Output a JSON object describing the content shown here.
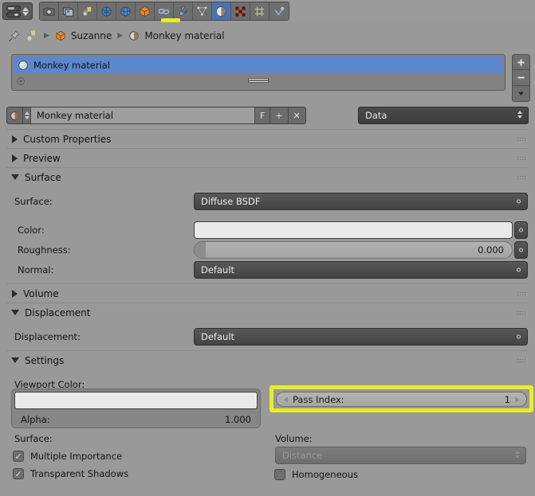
{
  "editor": {
    "type_label": "properties-editor"
  },
  "toolbar": {
    "tabs": [
      {
        "name": "render-tab",
        "icon": "camera-icon"
      },
      {
        "name": "output-tab",
        "icon": "printer-icon"
      },
      {
        "name": "view-layer-tab",
        "icon": "images-icon"
      },
      {
        "name": "scene-tab",
        "icon": "cone-sphere-icon"
      },
      {
        "name": "world-tab",
        "icon": "globe-icon"
      },
      {
        "name": "object-tab",
        "icon": "cube-icon"
      },
      {
        "name": "constraints-tab",
        "icon": "chain-icon"
      },
      {
        "name": "modifiers-tab",
        "icon": "wrench-icon"
      },
      {
        "name": "particles-tab",
        "icon": "particles-icon"
      },
      {
        "name": "material-tab",
        "icon": "material-sphere-icon",
        "active": true
      },
      {
        "name": "texture-tab",
        "icon": "checker-icon"
      },
      {
        "name": "physics-tab",
        "icon": "physics-icon"
      },
      {
        "name": "data-tab",
        "icon": "mesh-data-icon"
      }
    ]
  },
  "breadcrumb": {
    "pin_icon": "pin-icon",
    "root_icon": "material-data-icon",
    "items": [
      {
        "label": "Suzanne",
        "icon": "object-cube-icon"
      },
      {
        "label": "Monkey material",
        "icon": "material-sphere-icon"
      }
    ]
  },
  "slot_list": {
    "items": [
      {
        "label": "Monkey material",
        "selected": true
      }
    ],
    "add_icon": "plus-circle-icon",
    "side_buttons": [
      {
        "name": "add-slot-button",
        "glyph": "+"
      },
      {
        "name": "remove-slot-button",
        "glyph": "–"
      },
      {
        "name": "slot-specials-button",
        "glyph": "▾"
      }
    ]
  },
  "name_row": {
    "browse_icon": "material-browse-icon",
    "value": "Monkey material",
    "fake_user_label": "F",
    "new_label": "+",
    "unlink_label": "✕",
    "link_dropdown": {
      "value": "Data"
    }
  },
  "panels": [
    {
      "name": "custom-properties",
      "label": "Custom Properties",
      "open": false
    },
    {
      "name": "preview",
      "label": "Preview",
      "open": false
    },
    {
      "name": "surface",
      "label": "Surface",
      "open": true
    },
    {
      "name": "volume",
      "label": "Volume",
      "open": false
    },
    {
      "name": "displacement",
      "label": "Displacement",
      "open": true
    },
    {
      "name": "settings",
      "label": "Settings",
      "open": true
    }
  ],
  "surface": {
    "surface_label": "Surface:",
    "surface_value": "Diffuse BSDF",
    "color_label": "Color:",
    "color_value": "#e9e9e9",
    "roughness_label": "Roughness:",
    "roughness_value": "0.000",
    "normal_label": "Normal:",
    "normal_value": "Default"
  },
  "displacement": {
    "label": "Displacement:",
    "value": "Default"
  },
  "settings": {
    "viewport_color_label": "Viewport Color:",
    "viewport_color_value": "#e9e9e9",
    "alpha_label": "Alpha:",
    "alpha_value": "1.000",
    "pass_index_label": "Pass Index:",
    "pass_index_value": "1",
    "highlight_color": "#e8ee26",
    "surface_group_label": "Surface:",
    "multiple_importance_label": "Multiple Importance",
    "multiple_importance_checked": true,
    "transparent_shadows_label": "Transparent Shadows",
    "transparent_shadows_checked": true,
    "volume_group_label": "Volume:",
    "volume_sampling_value": "Distance",
    "homogeneous_label": "Homogeneous",
    "homogeneous_checked": false
  }
}
